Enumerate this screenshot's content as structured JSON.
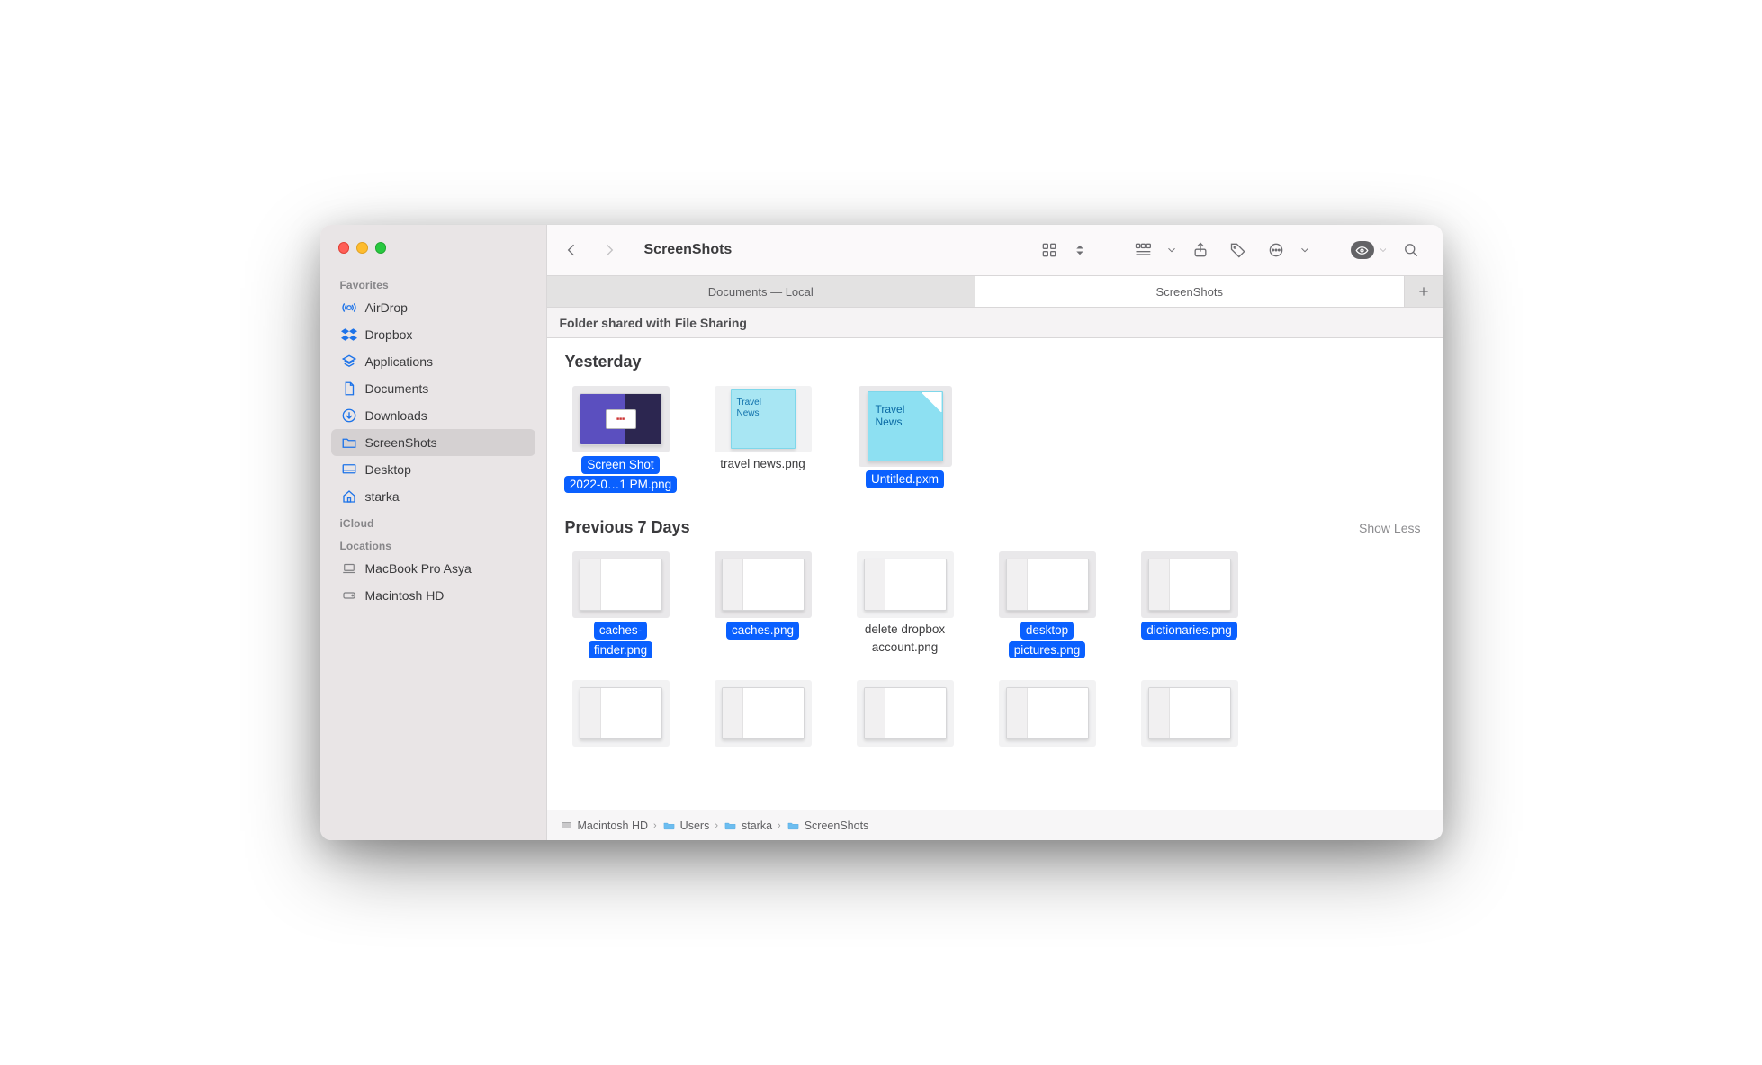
{
  "window_title": "ScreenShots",
  "sidebar": {
    "sections": [
      {
        "label": "Favorites",
        "items": [
          {
            "icon": "airdrop",
            "label": "AirDrop"
          },
          {
            "icon": "dropbox",
            "label": "Dropbox"
          },
          {
            "icon": "applications",
            "label": "Applications"
          },
          {
            "icon": "documents",
            "label": "Documents"
          },
          {
            "icon": "downloads",
            "label": "Downloads"
          },
          {
            "icon": "folder",
            "label": "ScreenShots",
            "selected": true
          },
          {
            "icon": "desktop",
            "label": "Desktop"
          },
          {
            "icon": "home",
            "label": "starka"
          }
        ]
      },
      {
        "label": "iCloud",
        "items": []
      },
      {
        "label": "Locations",
        "items": [
          {
            "icon": "laptop",
            "label": "MacBook Pro Asya"
          },
          {
            "icon": "disk",
            "label": "Macintosh HD"
          }
        ]
      }
    ]
  },
  "tabs": [
    {
      "label": "Documents — Local",
      "active": false
    },
    {
      "label": "ScreenShots",
      "active": true
    }
  ],
  "banner": "Folder shared with File Sharing",
  "groups": [
    {
      "title": "Yesterday",
      "action": "",
      "items": [
        {
          "kind": "screenshot",
          "label_lines": [
            "Screen Shot",
            "2022-0…1 PM.png"
          ],
          "selected": true,
          "thumb_hint": "purple"
        },
        {
          "kind": "sticky",
          "label": "travel news.png",
          "selected": false,
          "text": "Travel News"
        },
        {
          "kind": "sticky-big",
          "label": "Untitled.pxm",
          "selected": true,
          "text": "Travel News"
        }
      ]
    },
    {
      "title": "Previous 7 Days",
      "action": "Show Less",
      "items": [
        {
          "kind": "ui",
          "label_lines": [
            "caches-",
            "finder.png"
          ],
          "selected": true
        },
        {
          "kind": "ui",
          "label": "caches.png",
          "selected": true
        },
        {
          "kind": "ui",
          "label_lines": [
            "delete dropbox",
            "account.png"
          ],
          "selected": false
        },
        {
          "kind": "ui",
          "label_lines": [
            "desktop",
            "pictures.png"
          ],
          "selected": true
        },
        {
          "kind": "ui",
          "label": "dictionaries.png",
          "selected": true
        }
      ]
    }
  ],
  "breadcrumb": [
    {
      "icon": "hdd",
      "label": "Macintosh HD"
    },
    {
      "icon": "folder-sys",
      "label": "Users"
    },
    {
      "icon": "folder-sys",
      "label": "starka"
    },
    {
      "icon": "folder-sys",
      "label": "ScreenShots"
    }
  ]
}
